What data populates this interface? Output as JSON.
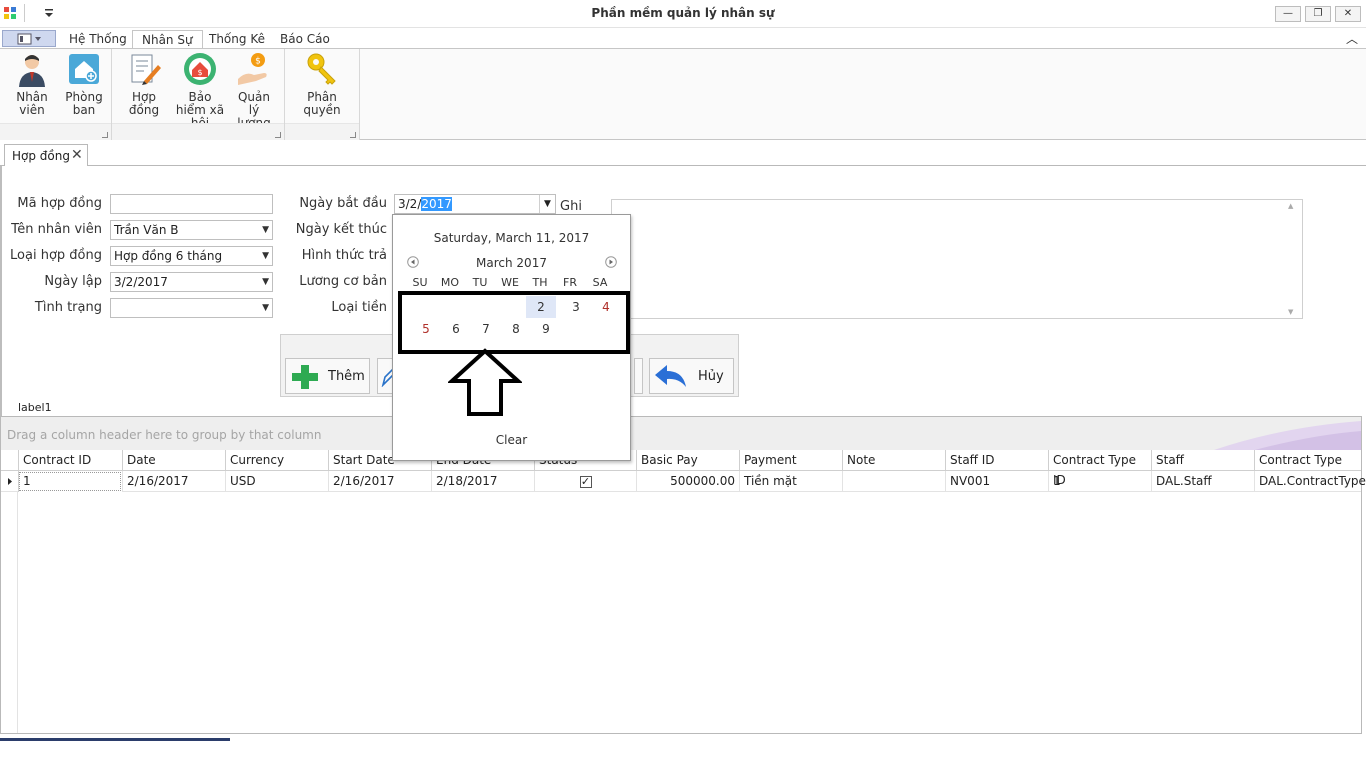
{
  "window": {
    "title": "Phần mềm quản lý nhân sự",
    "controls": {
      "minimize": "—",
      "restore": "❐",
      "close": "✕"
    }
  },
  "ribbon": {
    "tabs": [
      "Hệ Thống",
      "Nhân Sự",
      "Thống Kê",
      "Báo Cáo"
    ],
    "active_tab": "Nhân Sự",
    "buttons": [
      {
        "label": "Nhân viên",
        "icon": "employee-icon"
      },
      {
        "label": "Phòng ban",
        "icon": "department-icon"
      },
      {
        "label": "Hợp đồng",
        "icon": "contract-icon"
      },
      {
        "label": "Bảo hiểm xã hội",
        "icon": "insurance-icon"
      },
      {
        "label": "Quản lý lương",
        "icon": "salary-icon"
      },
      {
        "label": "Phân quyền",
        "icon": "key-icon"
      }
    ],
    "collapse_glyph": "︿"
  },
  "document_tab": {
    "label": "Hợp đồng",
    "close": "✕"
  },
  "form": {
    "labels": {
      "contract_id": "Mã hợp đồng",
      "employee_name": "Tên nhân viên",
      "contract_type": "Loại hợp đồng",
      "created_date": "Ngày lập",
      "status": "Tình trạng",
      "start_date": "Ngày bắt đầu",
      "end_date": "Ngày kết thúc",
      "payment_method": "Hình thức trả",
      "basic_salary": "Lương cơ bản",
      "currency": "Loại tiền",
      "notes": "Ghi chú"
    },
    "values": {
      "contract_id": "",
      "employee_name": "Trần Văn B",
      "contract_type": "Hợp đồng 6 tháng",
      "created_date": "3/2/2017",
      "status": "",
      "start_date_prefix": "3/2/",
      "start_date_selected": "2017"
    },
    "buttons": {
      "add": "Thêm",
      "cancel": "Hủy"
    },
    "label1": "label1"
  },
  "calendar": {
    "today_text": "Saturday, March 11, 2017",
    "month_text": "March 2017",
    "weekdays": [
      "SU",
      "MO",
      "TU",
      "WE",
      "TH",
      "FR",
      "SA"
    ],
    "days_row1": [
      "2",
      "3",
      "4"
    ],
    "days_row2": [
      "5",
      "6",
      "7",
      "8",
      "9"
    ],
    "selected_day": "2",
    "clear_label": "Clear"
  },
  "grid": {
    "group_panel_text": "Drag a column header here to group by that column",
    "columns": [
      "Contract ID",
      "Date",
      "Currency",
      "Start Date",
      "End Date",
      "Status",
      "Basic Pay",
      "Payment",
      "Note",
      "Staff ID",
      "Contract Type ID",
      "Staff",
      "Contract Type"
    ],
    "rows": [
      [
        "1",
        "2/16/2017",
        "USD",
        "2/16/2017",
        "2/18/2017",
        "✓",
        "500000.00",
        "Tiền mặt",
        "",
        "NV001",
        "1",
        "DAL.Staff",
        "DAL.ContractType"
      ]
    ]
  },
  "colors": {
    "accent": "#3399ff",
    "weekend": "#b0302a",
    "selected_day_bg": "#dfe7f7"
  }
}
